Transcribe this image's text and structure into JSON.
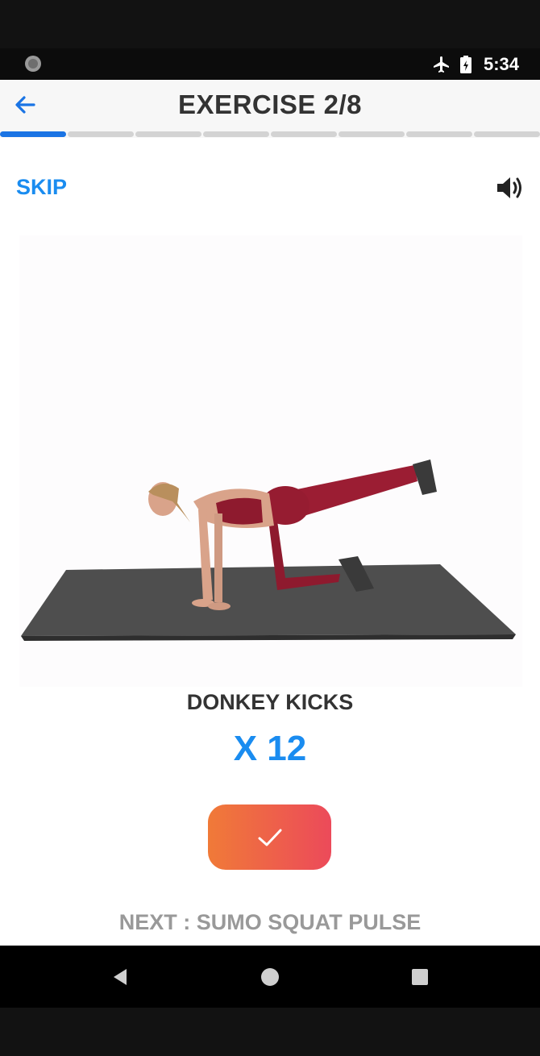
{
  "status_bar": {
    "time": "5:34",
    "icons": [
      "loading-circle-icon",
      "airplane-mode-icon",
      "battery-icon"
    ]
  },
  "header": {
    "back_icon": "arrow-left-icon",
    "title": "EXERCISE 2/8"
  },
  "progress": {
    "total_segments": 8,
    "completed_segments": 1,
    "active_color": "#1a74e4",
    "inactive_color": "#d3d3d3"
  },
  "controls": {
    "skip_label": "SKIP",
    "sound_icon": "volume-icon"
  },
  "exercise": {
    "image": "woman-doing-donkey-kicks-on-mat",
    "name": "DONKEY KICKS",
    "reps": "X 12"
  },
  "done_button": {
    "icon": "checkmark-icon",
    "gradient": [
      "#f07a38",
      "#ec4a5a"
    ]
  },
  "next": {
    "label": "NEXT : SUMO SQUAT PULSE"
  },
  "nav_bar": {
    "icons": [
      "back-triangle-icon",
      "home-circle-icon",
      "recents-square-icon"
    ]
  },
  "colors": {
    "accent": "#1a8cf0",
    "title_text": "#333333",
    "muted_text": "#999999"
  }
}
